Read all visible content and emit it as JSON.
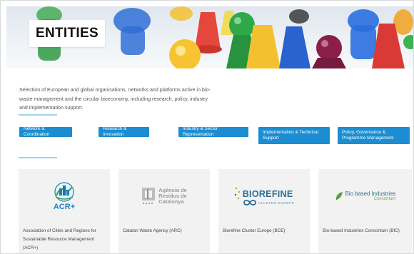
{
  "hero": {
    "title": "ENTITIES"
  },
  "intro": {
    "text": "Selection of European and global organisations, networks and platforms active in bio-waste management and the circular bioeconomy, including research, policy, industry and implementation support."
  },
  "filters": [
    {
      "label": "Network & Coordination"
    },
    {
      "label": "Research & Innovation"
    },
    {
      "label": "Industry & Sector Representation"
    },
    {
      "label": "Implementation & Technical Support"
    },
    {
      "label": "Policy, Governance & Programme Management"
    }
  ],
  "cards": [
    {
      "name": "Association of Cities and Regions for Sustainable Resource Management (ACR+)",
      "logo_text": "ACR+",
      "icon": "acr-globe-icon"
    },
    {
      "name": "Catalan Waste Agency (ARC)",
      "logo_text": [
        "Agència de",
        "Residus de",
        "Catalunya"
      ],
      "icon": "arc-logo-icon"
    },
    {
      "name": "Biorefine Cluster Europe (BCE)",
      "logo_text": "BIOREFINE",
      "logo_sub": "CLUSTER EUROPE",
      "icon": "biorefine-logo-icon"
    },
    {
      "name": "Bio-based Industries Consortium (BIC)",
      "logo_text": "Bio based Industries",
      "logo_sub": "Consortium",
      "icon": "leaf-icon"
    }
  ],
  "colors": {
    "accent": "#1d8dd1",
    "rule": "#9fd2ee",
    "card_bg": "#f2f2f2",
    "acr_blue": "#1f7fbf",
    "biorefine_blue": "#2b6d93",
    "bic_green": "#6fae3d"
  }
}
